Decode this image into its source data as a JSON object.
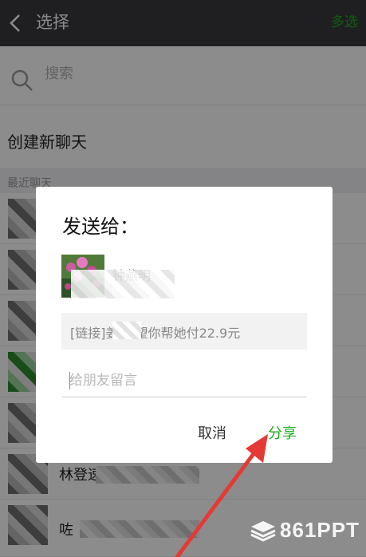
{
  "header": {
    "title": "选择",
    "action": "多选",
    "back_icon": "chevron-left-icon"
  },
  "search": {
    "placeholder": "搜索",
    "icon": "search-icon"
  },
  "new_chat": {
    "label": "创建新聊天"
  },
  "recent": {
    "label": "最近聊天"
  },
  "contacts_visible": [
    "林登速",
    "咗"
  ],
  "dialog": {
    "title": "发送给：",
    "recipient_name": "钟燕明",
    "link_text": "[链接]姜     希望你帮她付22.9元",
    "message_placeholder": "给朋友留言",
    "cancel_label": "取消",
    "share_label": "分享"
  },
  "watermark": {
    "text": "861PPT"
  },
  "colors": {
    "accent": "#1aad19",
    "topbar": "#393a3f",
    "arrow": "#e53935"
  }
}
